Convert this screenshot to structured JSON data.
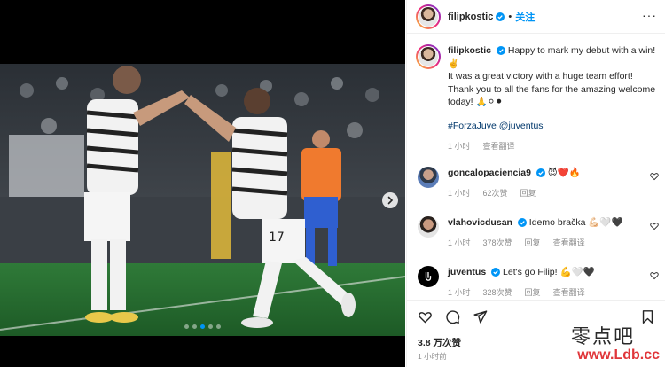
{
  "post": {
    "username": "filipkostic",
    "follow_label": "关注",
    "more_label": "···"
  },
  "caption": {
    "username": "filipkostic",
    "line1": "Happy to mark my debut with a win! ✌️",
    "line2": "It was a great victory with a huge team effort! Thank you to all the fans for the amazing welcome today! 🙏⚪⚫",
    "hashtag": "#ForzaJuve",
    "mention": "@juventus",
    "time": "1 小时",
    "see_translation": "查看翻译"
  },
  "comments": [
    {
      "username": "goncalopaciencia9",
      "text": "😈❤️🔥",
      "time": "1 小时",
      "likes": "62次赞",
      "reply": "回复",
      "see_translation": ""
    },
    {
      "username": "vlahovicdusan",
      "text": "Idemo bračka 💪🏻🤍🖤",
      "time": "1 小时",
      "likes": "378次赞",
      "reply": "回复",
      "see_translation": "查看翻译"
    },
    {
      "username": "juventus",
      "text": "Let's go Filip! 💪🤍🖤",
      "time": "1 小时",
      "likes": "328次赞",
      "reply": "回复",
      "see_translation": "查看翻译"
    }
  ],
  "actions": {
    "likes_count": "3.8 万次赞",
    "timestamp": "1 小时前"
  },
  "carousel": {
    "total": 5,
    "active_index": 2
  },
  "watermark": {
    "chinese": "零点吧",
    "url": "www.Ldb.cc"
  },
  "colors": {
    "accent": "#0095f6",
    "link": "#00376b",
    "muted": "#8e8e8e",
    "watermark_red": "#e0363a"
  }
}
